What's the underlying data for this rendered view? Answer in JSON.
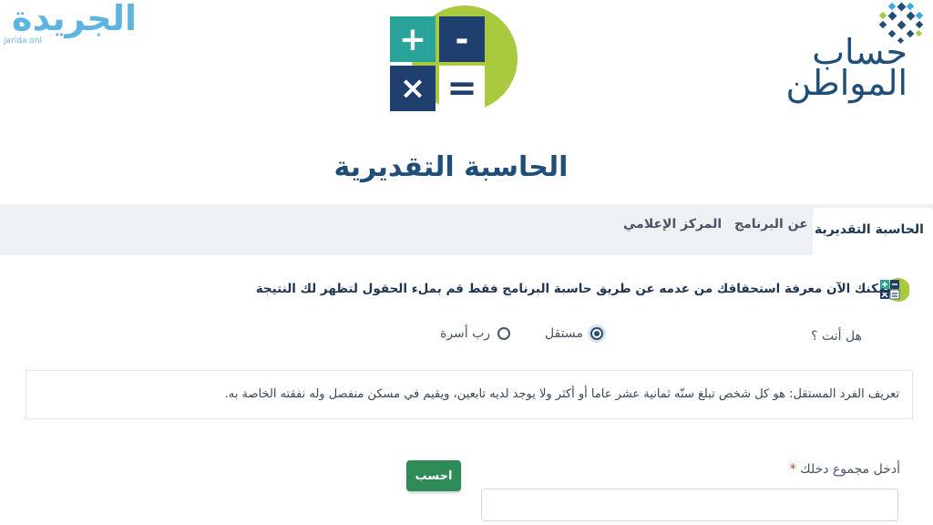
{
  "watermark": {
    "text": "الجريدة",
    "domain": "jarida.onl"
  },
  "logo": {
    "line1": "حساب",
    "line2": "المواطن"
  },
  "calculator_icon": {
    "plus": "+",
    "minus": "-",
    "times": "×",
    "equals": "="
  },
  "page_title": "الحاسبة التقديرية",
  "tabs": [
    {
      "label": "الحاسبة التقديرية",
      "active": true
    },
    {
      "label": "عن البرنامج",
      "active": false
    },
    {
      "label": "المركز الإعلامي",
      "active": false
    }
  ],
  "intro_text": "يمكنك الآن معرفة استحقاقك من عدمه عن طريق حاسبة البرنامج فقط قم بملء الحقول لتظهر لك النتيجة",
  "question": {
    "label": "هل أنت ؟",
    "options": [
      {
        "label": "مستقل",
        "checked": true
      },
      {
        "label": "رب أسرة",
        "checked": false
      }
    ]
  },
  "definition": "تعريف الفرد المستقل: هو كل شخص تبلغ سنّه ثمانية عشر عاما أو أكثر ولا يوجد لديه تابعين، ويقيم في مسكن منفصل وله نفقته الخاصة به.",
  "income": {
    "label": "أدخل مجموع دخلك",
    "required_mark": "*",
    "value": ""
  },
  "calculate_button": "احسب",
  "colors": {
    "brand_navy": "#1f4e79",
    "accent_green": "#a9c93f",
    "button_green": "#2e8b57",
    "calc_teal": "#2aa39a",
    "calc_navy": "#1f3f6e",
    "watermark_blue": "#3fa7dc"
  }
}
